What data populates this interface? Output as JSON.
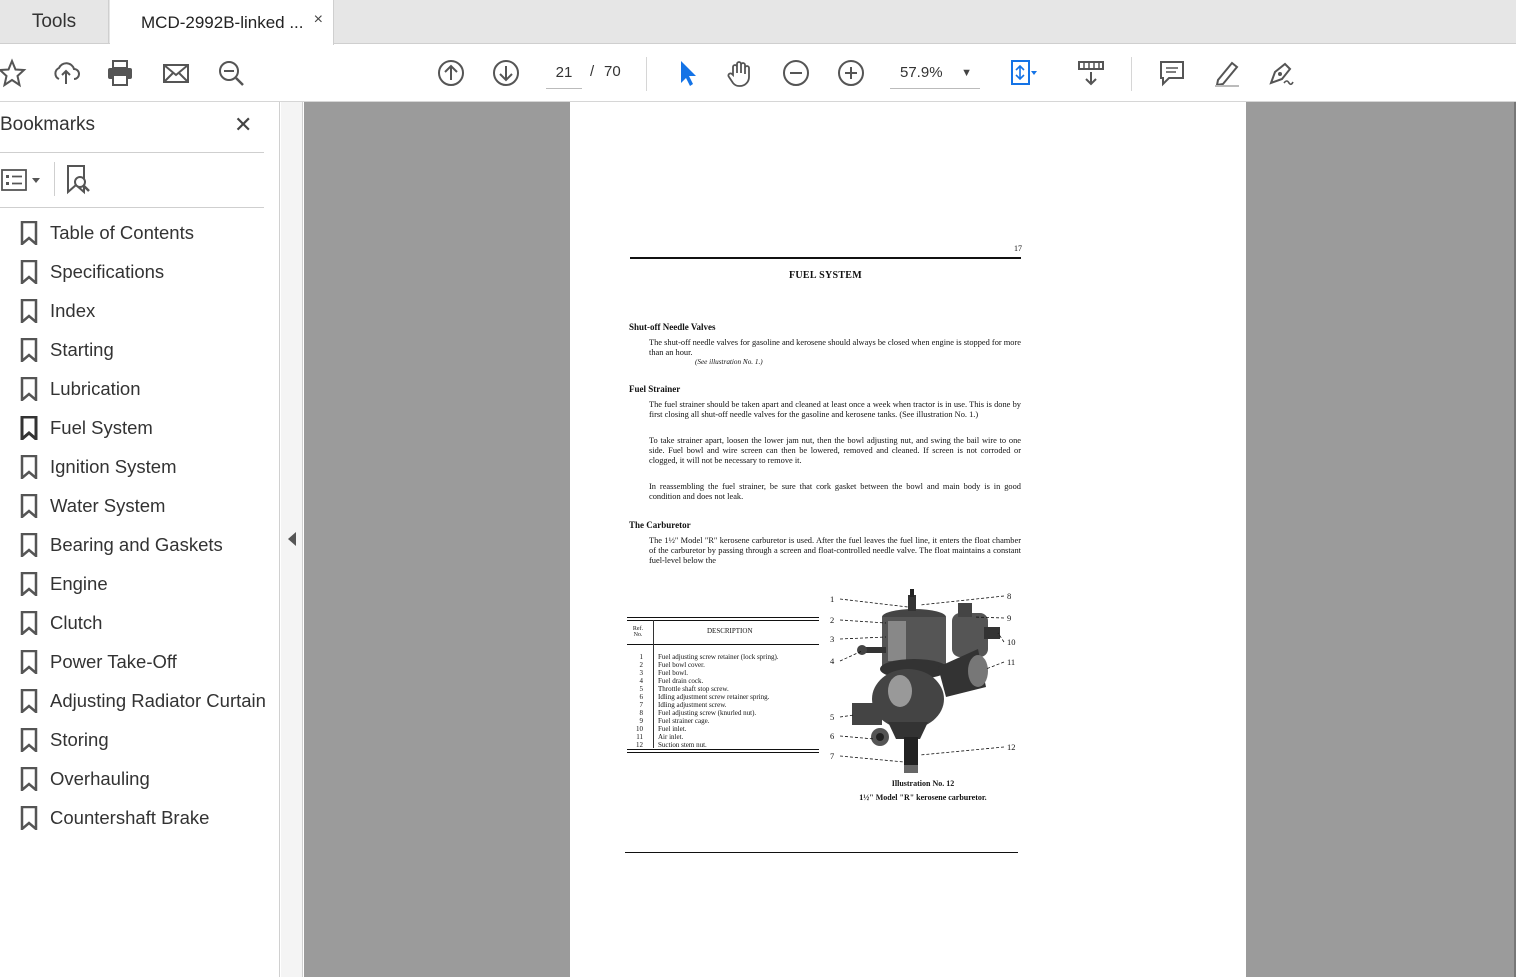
{
  "tabs": {
    "tools_label": "Tools",
    "doc_label": "MCD-2992B-linked ...",
    "close_symbol": "×"
  },
  "toolbar": {
    "page_current": "21",
    "page_separator": "/",
    "page_total": "70",
    "zoom": "57.9%",
    "accent_color": "#1473e6"
  },
  "sidebar": {
    "title": "Bookmarks",
    "close_symbol": "✕",
    "bookmarks": [
      {
        "label": "Table of Contents"
      },
      {
        "label": "Specifications"
      },
      {
        "label": "Index"
      },
      {
        "label": "Starting"
      },
      {
        "label": "Lubrication"
      },
      {
        "label": "Fuel System"
      },
      {
        "label": "Ignition System"
      },
      {
        "label": "Water System"
      },
      {
        "label": "Bearing and Gaskets"
      },
      {
        "label": "Engine"
      },
      {
        "label": "Clutch"
      },
      {
        "label": "Power Take-Off"
      },
      {
        "label": "Adjusting Radiator Curtain"
      },
      {
        "label": "Storing"
      },
      {
        "label": "Overhauling"
      },
      {
        "label": "Countershaft Brake"
      }
    ]
  },
  "document": {
    "page_number": "17",
    "title": "FUEL SYSTEM",
    "sections": [
      {
        "heading": "Shut-off Needle Valves",
        "paragraphs": [
          "The shut-off needle valves for gasoline and kerosene should always be closed when engine is stopped for more than an hour."
        ],
        "ref": "(See illustration No. 1.)"
      },
      {
        "heading": "Fuel Strainer",
        "paragraphs": [
          "The fuel strainer should be taken apart and cleaned at least once a week when tractor is in use.  This is done by first closing all shut-off needle valves for the gasoline and kerosene tanks.  (See illustration No. 1.)",
          "To take strainer apart, loosen the lower jam nut, then the bowl adjusting nut, and swing the bail wire to one side.  Fuel bowl and wire screen can then be lowered, removed and cleaned.  If screen is not corroded or clogged, it will not be necessary to remove it.",
          "In reassembling the fuel strainer, be sure that cork gasket between the bowl and main body is in good condition and does not leak."
        ]
      },
      {
        "heading": "The Carburetor",
        "paragraphs": [
          "The 1½\" Model \"R\" kerosene carburetor is used.  After the fuel leaves the fuel line, it enters the float chamber of the carburetor by passing through a screen and float-controlled needle valve.  The float maintains a constant fuel-level below the"
        ]
      }
    ],
    "table": {
      "ref_header": "Ref. No.",
      "desc_header": "DESCRIPTION",
      "rows": [
        {
          "n": "1",
          "d": "Fuel adjusting screw retainer (lock spring)."
        },
        {
          "n": "2",
          "d": "Fuel bowl cover."
        },
        {
          "n": "3",
          "d": "Fuel bowl."
        },
        {
          "n": "4",
          "d": "Fuel drain cock."
        },
        {
          "n": "5",
          "d": "Throttle shaft stop screw."
        },
        {
          "n": "6",
          "d": "Idling adjustment screw retainer spring."
        },
        {
          "n": "7",
          "d": "Idling adjustment screw."
        },
        {
          "n": "8",
          "d": "Fuel adjusting screw (knurled nut)."
        },
        {
          "n": "9",
          "d": "Fuel strainer cage."
        },
        {
          "n": "10",
          "d": "Fuel inlet."
        },
        {
          "n": "11",
          "d": "Air inlet."
        },
        {
          "n": "12",
          "d": "Suction stem nut."
        }
      ]
    },
    "illustration": {
      "callouts": [
        "1",
        "2",
        "3",
        "4",
        "5",
        "6",
        "7",
        "8",
        "9",
        "10",
        "11",
        "12"
      ],
      "caption_title": "Illustration No. 12",
      "caption_text": "1½\" Model \"R\" kerosene carburetor."
    }
  }
}
